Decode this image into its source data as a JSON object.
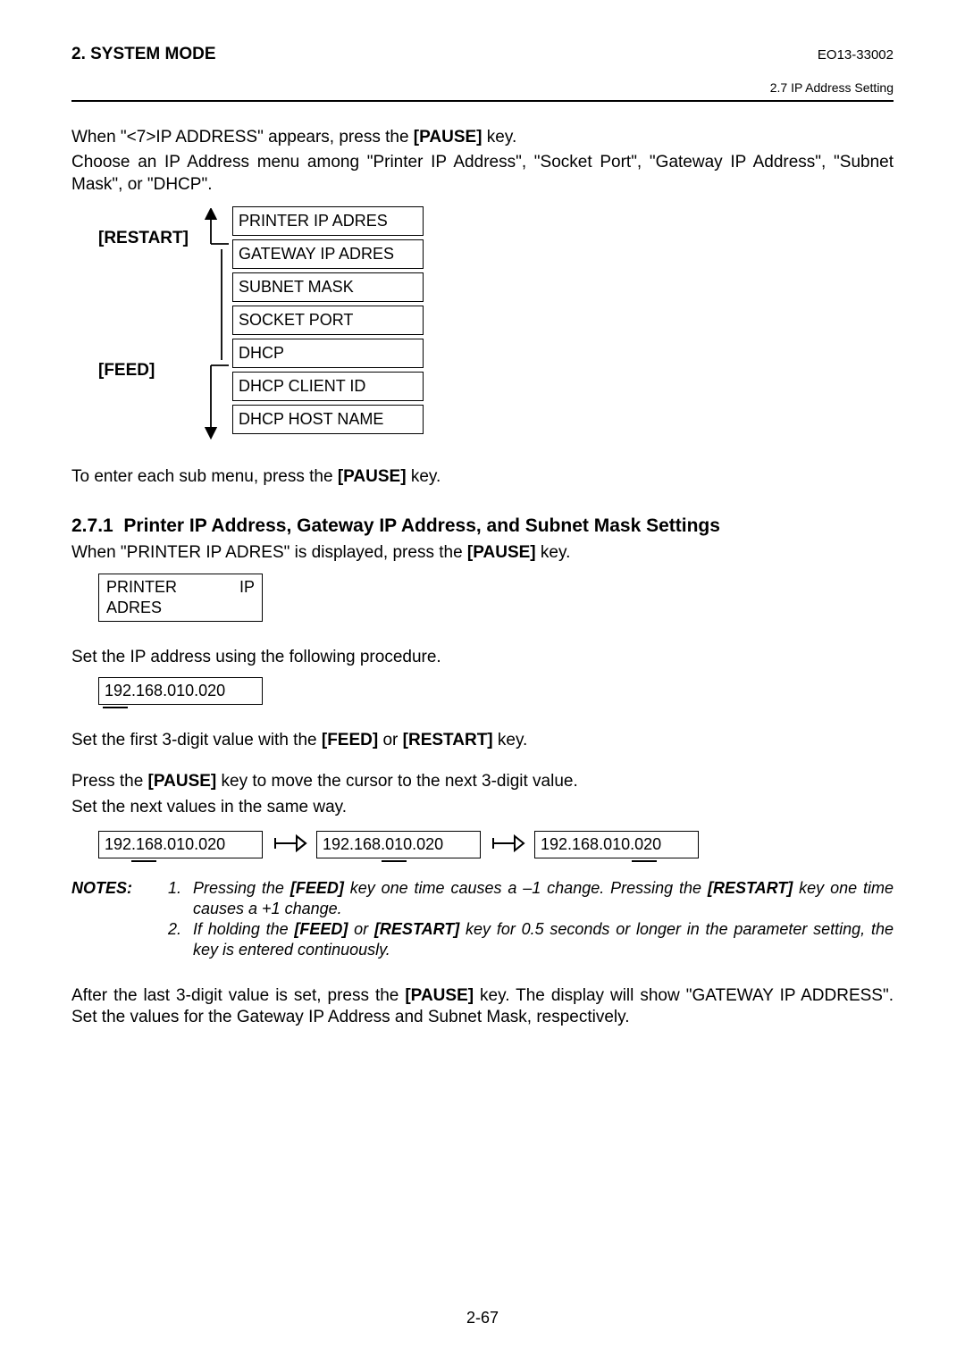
{
  "header": {
    "chapter": "2. SYSTEM MODE",
    "docnum": "EO13-33002",
    "section_crumb": "2.7 IP Address Setting"
  },
  "intro": {
    "line1a": "When \"<7>IP ADDRESS\" appears, press the ",
    "pause": "[PAUSE]",
    "line1b": " key.",
    "line2": "Choose an IP Address menu among \"Printer IP Address\", \"Socket Port\", \"Gateway IP Address\", \"Subnet Mask\", or \"DHCP\"."
  },
  "nav": {
    "restart": "[RESTART]",
    "feed": "[FEED]"
  },
  "menu_items": [
    "PRINTER IP ADRES",
    "GATEWAY IP ADRES",
    "SUBNET MASK",
    "SOCKET PORT",
    "DHCP",
    "DHCP CLIENT ID",
    "DHCP HOST NAME"
  ],
  "after_menu_a": "To enter each sub menu, press the ",
  "after_menu_b": " key.",
  "section": {
    "number": "2.7.1",
    "title": "Printer IP Address, Gateway IP Address, and Subnet Mask Settings"
  },
  "sect_line1a": "When \"PRINTER IP ADRES\" is displayed, press the ",
  "sect_line1b": " key.",
  "display1": "PRINTER IP ADRES",
  "sect_line2": "Set the IP address using the following procedure.",
  "ip1": "192.168.010.020",
  "sect_line3a": "Set the first 3-digit value with the ",
  "feed_key": "[FEED]",
  "or_word": " or ",
  "restart_key": "[RESTART]",
  "sect_line3b": " key.",
  "sect_line4a": "Press the ",
  "sect_line4b": " key to move the cursor to the next 3-digit value.",
  "sect_line5": "Set the next values in the same way.",
  "ip_steps": [
    "192.168.010.020",
    "192.168.010.020",
    "192.168.010.020"
  ],
  "notes": {
    "label": "NOTES:",
    "items": [
      {
        "num": "1.",
        "text_a": "Pressing the ",
        "k1": "[FEED]",
        "mid": " key one time causes a –1 change.  Pressing the ",
        "k2": "[RESTART]",
        "text_b": " key one time causes a +1 change."
      },
      {
        "num": "2.",
        "text_a": "If holding the ",
        "k1": "[FEED]",
        "mid": " or ",
        "k2": "[RESTART]",
        "text_b": " key for 0.5 seconds or longer in the parameter setting, the key is entered continuously."
      }
    ]
  },
  "closing_a": "After the last 3-digit value is set, press the ",
  "closing_b": " key.  The display will show \"GATEWAY IP ADDRESS\".  Set the values for the Gateway IP Address and Subnet Mask, respectively.",
  "footer": "2-67"
}
